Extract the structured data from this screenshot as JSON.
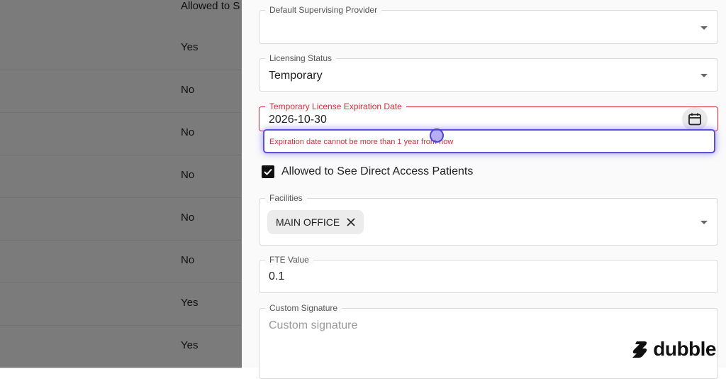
{
  "background_table": {
    "header": "Allowed to S",
    "rows": [
      "Yes",
      "No",
      "No",
      "No",
      "No",
      "No",
      "Yes",
      "Yes"
    ]
  },
  "form": {
    "supervising_provider": {
      "label": "Default Supervising Provider",
      "value": ""
    },
    "licensing_status": {
      "label": "Licensing Status",
      "value": "Temporary"
    },
    "expiration_date": {
      "label": "Temporary License Expiration Date",
      "value": "2026-10-30",
      "error": "Expiration date cannot be more than 1 year from now"
    },
    "direct_access": {
      "label": "Allowed to See Direct Access Patients",
      "checked": true
    },
    "facilities": {
      "label": "Facilities",
      "chip": "MAIN OFFICE"
    },
    "fte": {
      "label": "FTE Value",
      "value": "0.1"
    },
    "custom_signature": {
      "label": "Custom Signature",
      "placeholder": "Custom signature"
    }
  },
  "brand": {
    "name": "dubble"
  },
  "colors": {
    "error": "#d32f3a",
    "focus": "#5b4fe0"
  }
}
